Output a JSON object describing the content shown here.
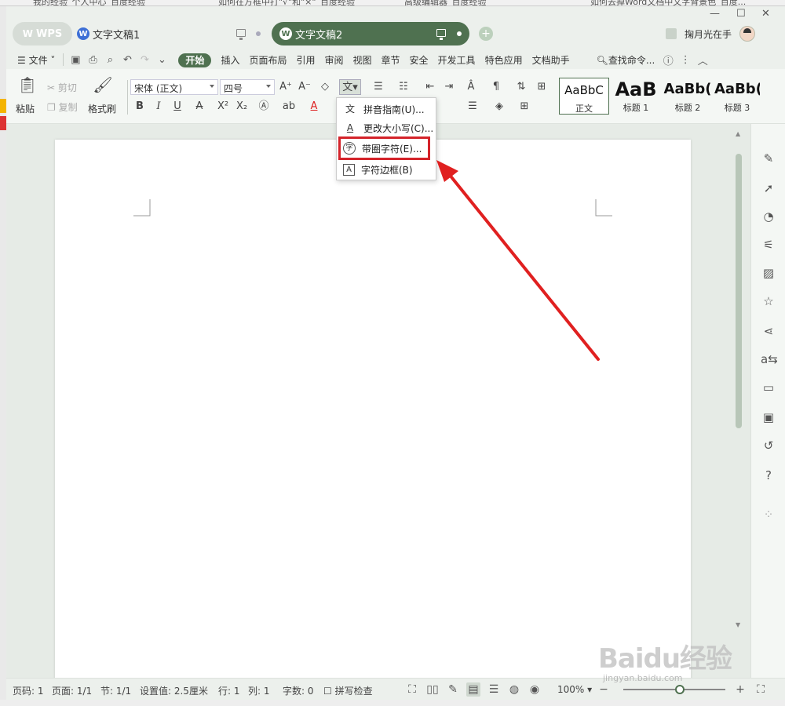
{
  "background_tabs": [
    "我的经验_个人中心_百度经验",
    "如何在方框中打\"√\"和\"×\"_百度经验",
    "高级编辑器_百度经验",
    "如何去掉Word文档中文字背景色_百度..."
  ],
  "window_controls": {
    "minimize": "—",
    "maximize": "☐",
    "close": "✕"
  },
  "titlebar": {
    "home_label": "WPS",
    "tabs": [
      {
        "label": "文字文稿1",
        "active": false
      },
      {
        "label": "文字文稿2",
        "active": true
      }
    ],
    "add_tab": "+",
    "user_name": "掬月光在手"
  },
  "menubar": {
    "file_label": "文件",
    "items": [
      "开始",
      "插入",
      "页面布局",
      "引用",
      "审阅",
      "视图",
      "章节",
      "安全",
      "开发工具",
      "特色应用",
      "文档助手"
    ],
    "active": "开始",
    "search_label": "查找命令..."
  },
  "ribbon": {
    "paste": "粘贴",
    "cut": "剪切",
    "copy": "复制",
    "format_painter": "格式刷",
    "font_family": "宋体 (正文)",
    "font_size": "四号",
    "bold": "B",
    "italic": "I",
    "underline": "U",
    "styles": [
      {
        "sample": "AaBbC",
        "caption": "正文"
      },
      {
        "sample": "AaB",
        "caption": "标题 1"
      },
      {
        "sample": "AaBb(",
        "caption": "标题 2"
      },
      {
        "sample": "AaBb(",
        "caption": "标题 3"
      }
    ]
  },
  "dropdown": {
    "items": [
      {
        "icon": "文",
        "label": "拼音指南(U)..."
      },
      {
        "icon": "A",
        "label": "更改大小写(C)..."
      },
      {
        "icon": "字",
        "label": "带圈字符(E)..."
      },
      {
        "icon": "A",
        "label": "字符边框(B)"
      }
    ],
    "highlighted_index": 2
  },
  "statusbar": {
    "page_num": "页码: 1",
    "pages": "页面: 1/1",
    "section": "节: 1/1",
    "setting": "设置值: 2.5厘米",
    "row": "行: 1",
    "col": "列: 1",
    "word_count": "字数: 0",
    "spell_check": "拼写检查",
    "zoom": "100%",
    "zoom_fraction": 0.55
  },
  "watermark": {
    "brand": "Baidu经验",
    "site": "jingyan.baidu.com"
  },
  "colors": {
    "accent": "#4f7150",
    "highlight": "#d4232a",
    "arrow": "#e02020"
  }
}
